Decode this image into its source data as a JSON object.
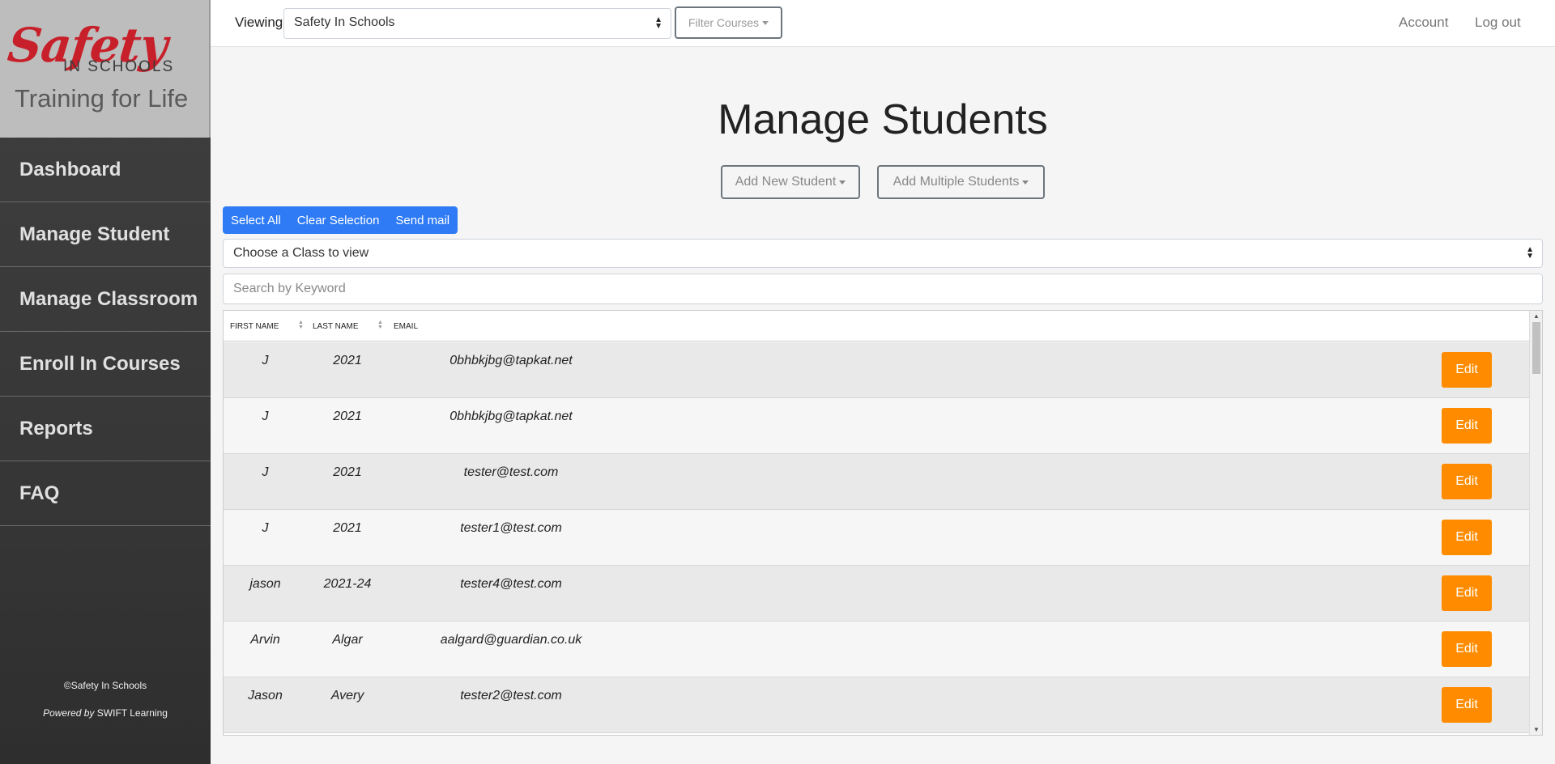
{
  "sidebar": {
    "logo": {
      "brand": "Safety",
      "sub": "IN SCHOOLS",
      "tagline": "Training for Life",
      "brand_color": "#c8202a"
    },
    "items": [
      {
        "label": "Dashboard"
      },
      {
        "label": "Manage Student"
      },
      {
        "label": "Manage Classroom"
      },
      {
        "label": "Enroll In Courses"
      },
      {
        "label": "Reports"
      },
      {
        "label": "FAQ"
      }
    ],
    "footer": {
      "copyright": "©Safety In Schools",
      "powered_prefix": "Powered by",
      "powered_name": "SWIFT Learning"
    }
  },
  "topbar": {
    "viewing_label": "Viewing:",
    "viewing_value": "Safety In Schools",
    "filter_label": "Filter Courses",
    "account_label": "Account",
    "logout_label": "Log out"
  },
  "main": {
    "title": "Manage Students",
    "add_new_label": "Add New Student",
    "add_multiple_label": "Add Multiple Students",
    "select_all": "Select All",
    "clear_selection": "Clear Selection",
    "send_mail": "Send mail",
    "class_select_value": "Choose a Class to view",
    "search_placeholder": "Search by Keyword",
    "accent": "#2f7bf5",
    "edit_color": "#ff8c00"
  },
  "table": {
    "columns": [
      "FIRST NAME",
      "LAST NAME",
      "EMAIL"
    ],
    "rows": [
      {
        "first": "J",
        "last": "2021",
        "email": "0bhbkjbg@tapkat.net"
      },
      {
        "first": "J",
        "last": "2021",
        "email": "0bhbkjbg@tapkat.net"
      },
      {
        "first": "J",
        "last": "2021",
        "email": "tester@test.com"
      },
      {
        "first": "J",
        "last": "2021",
        "email": "tester1@test.com"
      },
      {
        "first": "jason",
        "last": "2021-24",
        "email": "tester4@test.com"
      },
      {
        "first": "Arvin",
        "last": "Algar",
        "email": "aalgard@guardian.co.uk"
      },
      {
        "first": "Jason",
        "last": "Avery",
        "email": "tester2@test.com"
      }
    ],
    "edit_label": "Edit"
  }
}
